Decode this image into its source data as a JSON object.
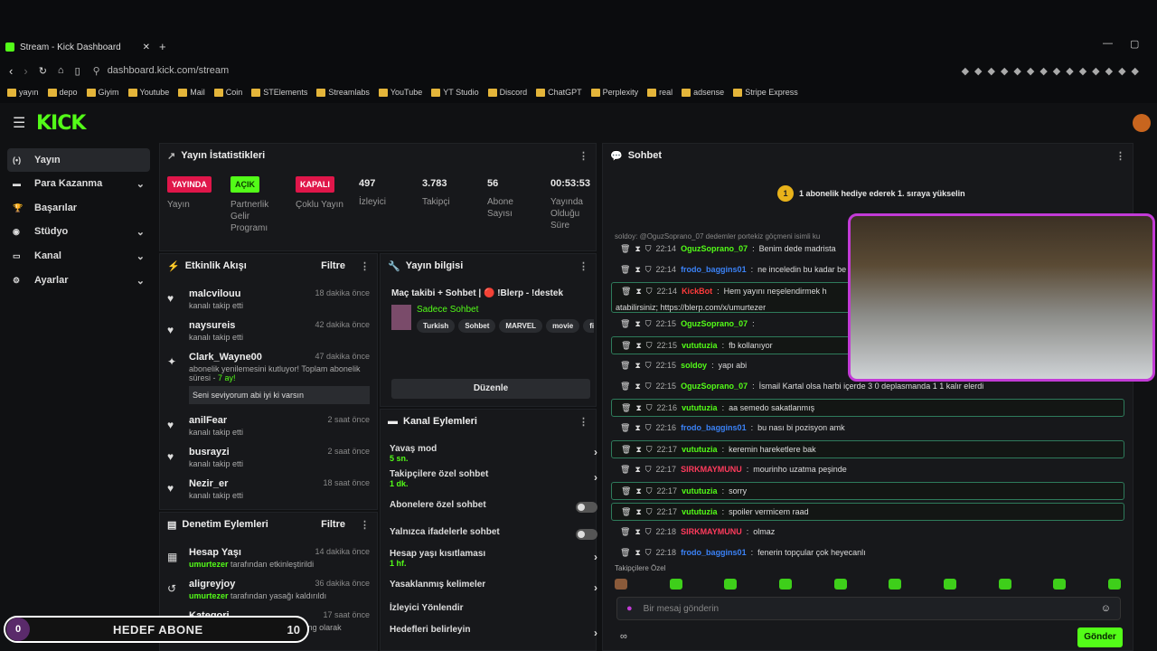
{
  "browser": {
    "tab_title": "Stream - Kick Dashboard",
    "url": "dashboard.kick.com/stream",
    "bookmarks": [
      "yayın",
      "depo",
      "Giyim",
      "Youtube",
      "Mail",
      "Coin",
      "STElements",
      "Streamlabs",
      "YouTube",
      "YT Studio",
      "Discord",
      "ChatGPT",
      "Perplexity",
      "real",
      "adsense",
      "Stripe Express"
    ]
  },
  "sidebar": {
    "items": [
      {
        "label": "Yayın"
      },
      {
        "label": "Para Kazanma"
      },
      {
        "label": "Başarılar"
      },
      {
        "label": "Stüdyo"
      },
      {
        "label": "Kanal"
      },
      {
        "label": "Ayarlar"
      }
    ]
  },
  "stats": {
    "title": "Yayın İstatistikleri",
    "live_badge": "YAYINDA",
    "live_label": "Yayın",
    "partner_badge": "AÇIK",
    "partner_label": "Partnerlik Gelir Programı",
    "multi_badge": "KAPALI",
    "multi_label": "Çoklu Yayın",
    "viewers": "497",
    "viewers_label": "İzleyici",
    "followers": "3.783",
    "followers_label": "Takipçi",
    "subs": "56",
    "subs_label": "Abone Sayısı",
    "uptime": "00:53:53",
    "uptime_label": "Yayında Olduğu Süre"
  },
  "activity": {
    "title": "Etkinlik Akışı",
    "filter": "Filtre",
    "items": [
      {
        "name": "malcvilouu",
        "action": "kanalı takip etti",
        "time": "18 dakika önce"
      },
      {
        "name": "naysureis",
        "action": "kanalı takip etti",
        "time": "42 dakika önce"
      },
      {
        "name": "Clark_Wayne00",
        "action": "abonelik yenilemesini kutluyor! Toplam abonelik süresi - ",
        "months": "7 ay!",
        "message": "Seni seviyorum abi iyi ki varsın",
        "time": "47 dakika önce"
      },
      {
        "name": "anilFear",
        "action": "kanalı takip etti",
        "time": "2 saat önce"
      },
      {
        "name": "busrayzi",
        "action": "kanalı takip etti",
        "time": "2 saat önce"
      },
      {
        "name": "Nezir_er",
        "action": "kanalı takip etti",
        "time": "18 saat önce"
      }
    ]
  },
  "moderation": {
    "title": "Denetim Eylemleri",
    "filter": "Filtre",
    "items": [
      {
        "name": "Hesap Yaşı",
        "by": "umurtezer",
        "action": "tarafından etkinleştirildi",
        "time": "14 dakika önce"
      },
      {
        "name": "aligreyjoy",
        "by": "umurtezer",
        "action": "tarafından yasağı kaldırıldı",
        "time": "36 dakika önce"
      },
      {
        "name": "Kategori",
        "by": "umurtezer",
        "action": "tarafından Just Chatting olarak değiştirildi",
        "time": "17 saat önce"
      }
    ]
  },
  "stream_info": {
    "title": "Yayın bilgisi",
    "stream_title": "Maç takibi + Sohbet | 🔴 !Blerp - !destek",
    "category": "Sadece Sohbet",
    "tags": [
      "Turkish",
      "Sohbet",
      "MARVEL",
      "movie",
      "fil"
    ],
    "edit": "Düzenle"
  },
  "channel_actions": {
    "title": "Kanal Eylemleri",
    "items": [
      {
        "label": "Yavaş mod",
        "detail": "5 sn.",
        "type": "arrow"
      },
      {
        "label": "Takipçilere özel sohbet",
        "detail": "1 dk.",
        "type": "arrow"
      },
      {
        "label": "Abonelere özel sohbet",
        "detail": "",
        "type": "toggle"
      },
      {
        "label": "Yalnızca ifadelerle sohbet",
        "detail": "",
        "type": "toggle"
      },
      {
        "label": "Hesap yaşı kısıtlaması",
        "detail": "1 hf.",
        "type": "arrow"
      },
      {
        "label": "Yasaklanmış kelimeler",
        "detail": "",
        "type": "arrow"
      },
      {
        "label": "İzleyici Yönlendir",
        "detail": "",
        "type": "none"
      },
      {
        "label": "Hedefleri belirleyin",
        "detail": "",
        "type": "arrow"
      }
    ]
  },
  "chat": {
    "title": "Sohbet",
    "gift_rank": "1",
    "gift_text": "1 abonelik hediye ederek 1. sıraya yükselin",
    "pinned": "soldoy: @OguzSoprano_07 dedemler portekiz göçmeni isimli ku",
    "messages": [
      {
        "time": "22:14",
        "user": "OguzSoprano_07",
        "color": "#53fc18",
        "text": "Benim dede madrista",
        "hl": false
      },
      {
        "time": "22:14",
        "user": "frodo_baggins01",
        "color": "#3b82f6",
        "text": "ne inceledin bu kadar be",
        "hl": false
      },
      {
        "time": "22:14",
        "user": "KickBot",
        "color": "#ff3b3b",
        "text": "Hem yayını neşelendirmek h",
        "hl": true,
        "cont": "atabilirsiniz; https://blerp.com/x/umurtezer"
      },
      {
        "time": "22:15",
        "user": "OguzSoprano_07",
        "color": "#53fc18",
        "text": "",
        "hl": false
      },
      {
        "time": "22:15",
        "user": "vututuzia",
        "color": "#53fc18",
        "text": "fb kollanıyor",
        "hl": true
      },
      {
        "time": "22:15",
        "user": "soldoy",
        "color": "#53fc18",
        "text": "yapı abi",
        "hl": false
      },
      {
        "time": "22:15",
        "user": "OguzSoprano_07",
        "color": "#53fc18",
        "text": "İsmail Kartal olsa harbi içerde 3 0 deplasmanda 1 1 kalır elerdi",
        "hl": false
      },
      {
        "time": "22:16",
        "user": "vututuzia",
        "color": "#53fc18",
        "text": "aa semedo sakatlanmış",
        "hl": true
      },
      {
        "time": "22:16",
        "user": "frodo_baggins01",
        "color": "#3b82f6",
        "text": "bu nası bi pozisyon amk",
        "hl": false
      },
      {
        "time": "22:17",
        "user": "vututuzia",
        "color": "#53fc18",
        "text": "keremin hareketlere bak",
        "hl": true
      },
      {
        "time": "22:17",
        "user": "SIRKMAYMUNU",
        "color": "#ff3b5c",
        "text": "mourinho uzatma peşinde",
        "hl": false
      },
      {
        "time": "22:17",
        "user": "vututuzia",
        "color": "#53fc18",
        "text": "sorry",
        "hl": true
      },
      {
        "time": "22:17",
        "user": "vututuzia",
        "color": "#53fc18",
        "text": "spoiler vermicem raad",
        "hl": true
      },
      {
        "time": "22:18",
        "user": "SIRKMAYMUNU",
        "color": "#ff3b5c",
        "text": "olmaz",
        "hl": false
      },
      {
        "time": "22:18",
        "user": "frodo_baggins01",
        "color": "#3b82f6",
        "text": "fenerin topçular çok heyecanlı",
        "hl": false
      }
    ],
    "followers_only_label": "Takipçilere Özel",
    "input_placeholder": "Bir mesaj gönderin",
    "send": "Gönder"
  },
  "goal": {
    "start": "0",
    "label": "HEDEF ABONE",
    "target": "10"
  }
}
